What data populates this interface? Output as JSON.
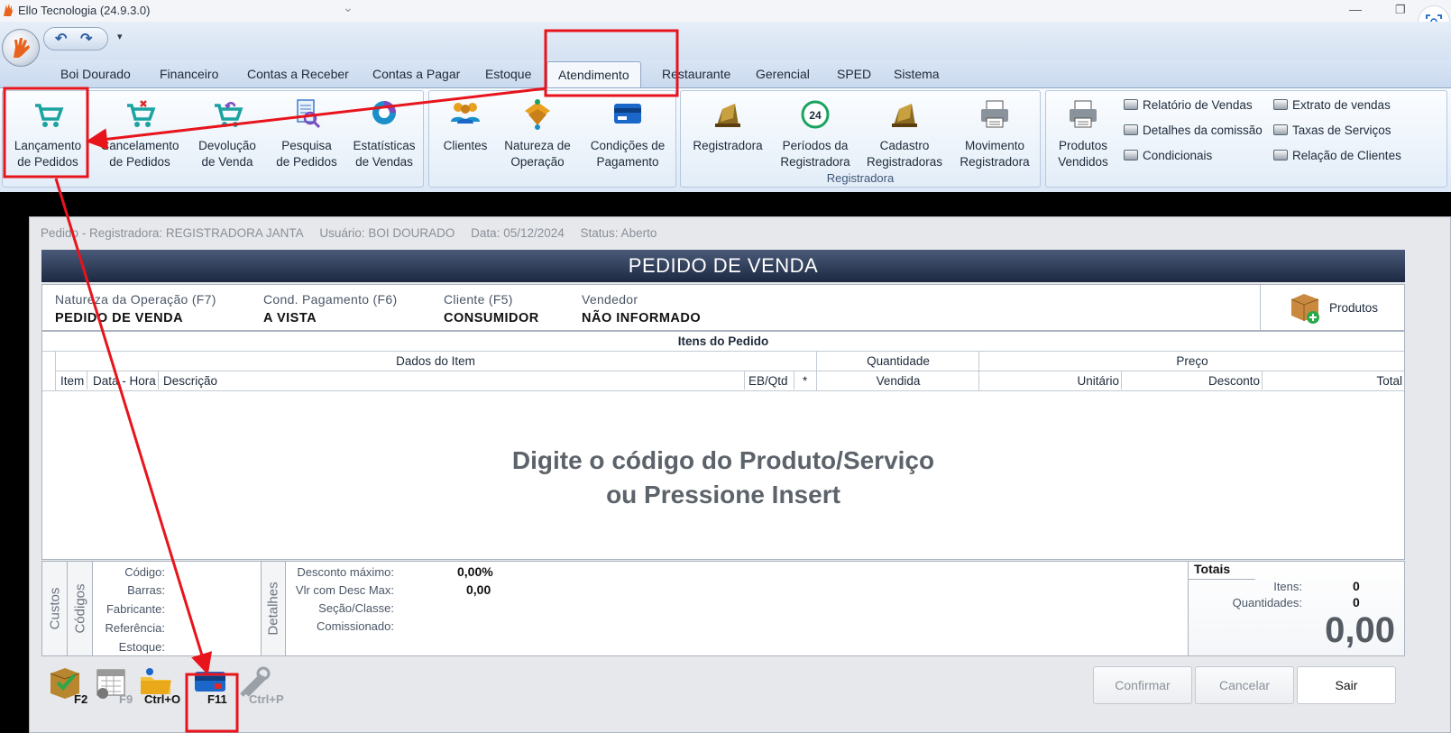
{
  "window": {
    "title": "Ello Tecnologia (24.9.3.0)",
    "minimize_glyph": "—",
    "restore_glyph": "❐"
  },
  "tabs": [
    "Boi Dourado",
    "Financeiro",
    "Contas a Receber",
    "Contas a Pagar",
    "Estoque",
    "Atendimento",
    "Restaurante",
    "Gerencial",
    "SPED",
    "Sistema"
  ],
  "active_tab": "Atendimento",
  "ribbon": {
    "lancamento": [
      "Lançamento",
      "de Pedidos"
    ],
    "cancelamento": [
      "Cancelamento",
      "de Pedidos"
    ],
    "devolucao": [
      "Devolução",
      "de Venda"
    ],
    "pesquisa": [
      "Pesquisa",
      "de Pedidos"
    ],
    "estatisticas": [
      "Estatísticas",
      "de Vendas"
    ],
    "clientes": [
      "Clientes",
      ""
    ],
    "natureza": [
      "Natureza de",
      "Operação"
    ],
    "condicoes": [
      "Condições de",
      "Pagamento"
    ],
    "registradora": [
      "Registradora",
      ""
    ],
    "periodos": [
      "Períodos da",
      "Registradora"
    ],
    "cadastro": [
      "Cadastro",
      "Registradoras"
    ],
    "movimento": [
      "Movimento",
      "Registradora"
    ],
    "registradora_group": "Registradora",
    "periodos_badge": "24",
    "produtos_vendidos": [
      "Produtos",
      "Vendidos"
    ],
    "reports_col1": [
      "Relatório de Vendas",
      "Detalhes da comissão",
      "Condicionais"
    ],
    "reports_col2": [
      "Extrato de vendas",
      "Taxas de Serviços",
      "Relação de Clientes"
    ]
  },
  "order": {
    "title_parts": [
      "Pedido - Registradora: REGISTRADORA JANTA",
      "Usuário: BOI DOURADO",
      "Data: 05/12/2024",
      "Status: Aberto"
    ],
    "banner": "PEDIDO DE VENDA",
    "natureza_label": "Natureza da Operação (F7)",
    "natureza_value": "PEDIDO DE VENDA",
    "cond_label": "Cond. Pagamento (F6)",
    "cond_value": "A VISTA",
    "cliente_label": "Cliente (F5)",
    "cliente_value": "CONSUMIDOR",
    "vendedor_label": "Vendedor",
    "vendedor_value": "NÃO INFORMADO",
    "produtos_button": "Produtos"
  },
  "grid": {
    "caption": "Itens do Pedido",
    "group_headers": [
      "Dados do Item",
      "Quantidade",
      "Preço"
    ],
    "columns": [
      "Item",
      "Data - Hora",
      "Descrição",
      "EB/Qtd",
      "*",
      "Vendida",
      "Unitário",
      "Desconto",
      "Total"
    ],
    "placeholder_line1": "Digite o código do Produto/Serviço",
    "placeholder_line2": "ou Pressione Insert"
  },
  "details": {
    "tabs": [
      "Custos",
      "Códigos",
      "Detalhes"
    ],
    "product_labels": [
      "Código:",
      "Barras:",
      "Fabricante:",
      "Referência:",
      "Estoque:"
    ],
    "desc_max_label": "Desconto máximo:",
    "desc_max_value": "0,00%",
    "vlr_desc_label": "Vlr com Desc Max:",
    "vlr_desc_value": "0,00",
    "secao_label": "Seção/Classe:",
    "comissionado_label": "Comissionado:",
    "totals_header": "Totais",
    "itens_label": "Itens:",
    "itens_value": "0",
    "quantidades_label": "Quantidades:",
    "quantidades_value": "0",
    "total_value": "0,00"
  },
  "toolbar": {
    "keys": [
      "F2",
      "F9",
      "Ctrl+O",
      "F11",
      "Ctrl+P"
    ],
    "confirmar": "Confirmar",
    "cancelar": "Cancelar",
    "sair": "Sair"
  },
  "colors": {
    "annotation": "#e8141c",
    "banner": "#1d2942",
    "accent": "#1a8fc9"
  }
}
